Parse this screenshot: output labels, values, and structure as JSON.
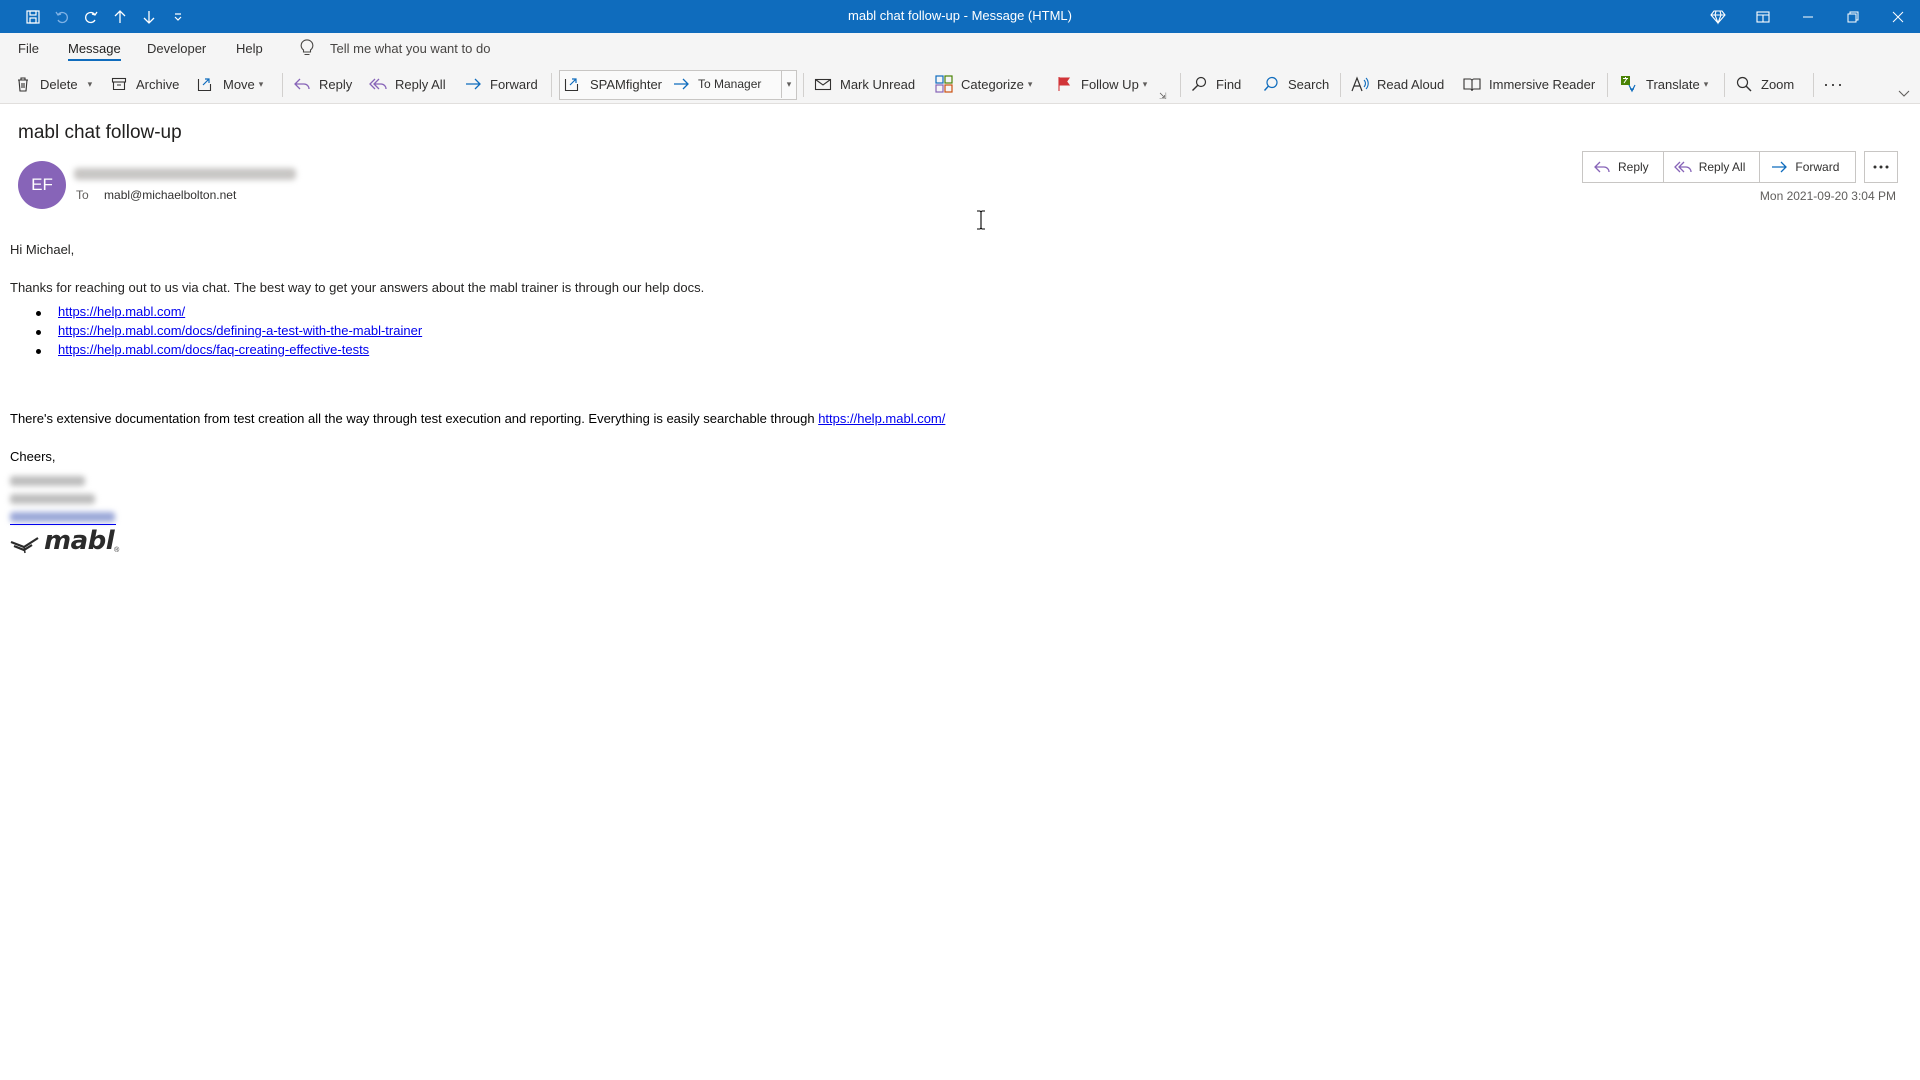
{
  "window": {
    "title": "mabl chat follow-up  -  Message (HTML)",
    "accent_color": "#0f6cbd",
    "quick_access_icons": [
      "save-icon",
      "undo-icon",
      "redo-icon",
      "up-arrow-icon",
      "down-arrow-icon",
      "customize-qat-icon"
    ],
    "right_icons": [
      "diamond-icon",
      "ribbon-display-icon",
      "minimize-icon",
      "restore-icon",
      "close-icon"
    ]
  },
  "menu": {
    "tabs": [
      "File",
      "Message",
      "Developer",
      "Help"
    ],
    "active_tab": "Message",
    "tell_me": "Tell me what you want to do"
  },
  "ribbon": {
    "delete": "Delete",
    "archive": "Archive",
    "move": "Move",
    "reply": "Reply",
    "reply_all": "Reply All",
    "forward": "Forward",
    "quick_step_1": "SPAMfighter",
    "quick_step_2": "To Manager",
    "mark_unread": "Mark Unread",
    "categorize": "Categorize",
    "follow_up": "Follow Up",
    "find": "Find",
    "search": "Search",
    "read_aloud": "Read Aloud",
    "immersive_reader": "Immersive Reader",
    "translate": "Translate",
    "zoom": "Zoom"
  },
  "message": {
    "subject": "mabl chat follow-up",
    "avatar_initials": "EF",
    "avatar_color": "#8764b8",
    "to_label": "To",
    "to_address": "mabl@michaelbolton.net",
    "date": "Mon 2021-09-20 3:04 PM",
    "actions": {
      "reply": "Reply",
      "reply_all": "Reply All",
      "forward": "Forward"
    }
  },
  "body": {
    "greeting": "Hi Michael,",
    "para1": "Thanks for reaching out to us via chat. The best way to get your answers about the mabl trainer is through our help docs.",
    "links": [
      "https://help.mabl.com/",
      "https://help.mabl.com/docs/defining-a-test-with-the-mabl-trainer",
      "https://help.mabl.com/docs/faq-creating-effective-tests"
    ],
    "para2_text": "There's extensive documentation from test creation all the way through test execution and reporting. Everything is easily searchable through ",
    "para2_link": "https://help.mabl.com/",
    "closing": "Cheers,",
    "logo_text": "mabl",
    "logo_tm": "®"
  }
}
